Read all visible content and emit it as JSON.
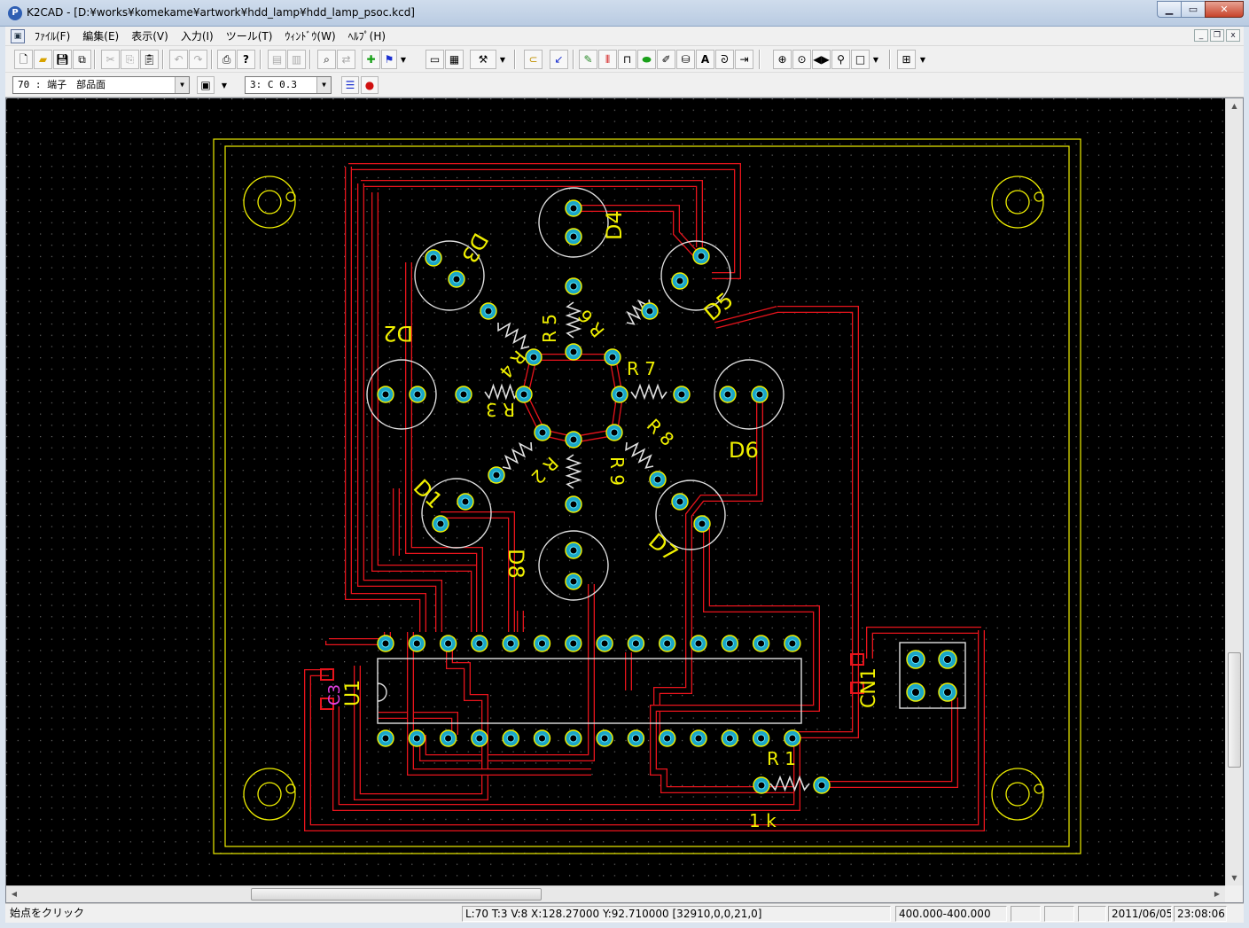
{
  "window": {
    "app_icon": "P",
    "title": "K2CAD - [D:¥works¥komekame¥artwork¥hdd_lamp¥hdd_lamp_psoc.kcd]",
    "minimize": "▁",
    "maximize": "▭",
    "close": "✕"
  },
  "menu": {
    "items": [
      "ﾌｧｲﾙ(F)",
      "編集(E)",
      "表示(V)",
      "入力(I)",
      "ツール(T)",
      "ｳｨﾝﾄﾞｳ(W)",
      "ﾍﾙﾌﾟ(H)"
    ],
    "mdi_minimize": "_",
    "mdi_restore": "❐",
    "mdi_close": "x"
  },
  "toolbar2": {
    "layer_select": "70 : 端子　部品面",
    "grid_select": "3: C 0.3"
  },
  "pcb": {
    "labels": {
      "d1": "D1",
      "d2": "D2",
      "d3": "D3",
      "d4": "D4",
      "d5": "D5",
      "d6": "D6",
      "d7": "D7",
      "d8": "D8",
      "r1": "R 1",
      "r1_value": "1 k",
      "r2": "R 2",
      "r3": "R 3",
      "r4": "R 4",
      "r5": "R 5",
      "r6": "R 6",
      "r7": "R 7",
      "r8": "R 8",
      "r9": "R 9",
      "u1": "U1",
      "cn1": "CN1",
      "c3": "C3"
    },
    "colors": {
      "background": "#000000",
      "trace": "#e8141c",
      "outline": "#f0f000",
      "silk": "#e0e0e0",
      "pad": "#27c5e8",
      "pad_ring": "#f0f000",
      "label": "#f0f000",
      "grid_dot": "#6a6a6a"
    }
  },
  "statusbar": {
    "hint": "始点をクリック",
    "coords": "L:70 T:3 V:8 X:128.27000 Y:92.710000 [32910,0,0,21,0]",
    "range": "400.000-400.000",
    "date": "2011/06/05",
    "time": "23:08:06"
  }
}
